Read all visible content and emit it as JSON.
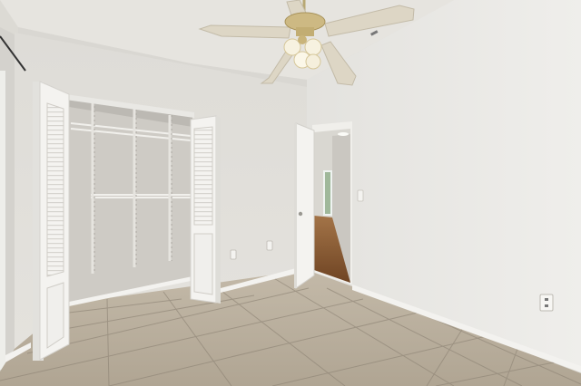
{
  "scene": {
    "colors": {
      "ceiling": "#e6e4df",
      "left_wall": "#d8d6d1",
      "back_wall": "#e2e0dc",
      "right_wall": "#e8e7e4",
      "closet_interior": "#cfcdc8",
      "floor_tile": "#b8ad9c",
      "grout": "#8f8576",
      "baseboard": "#f2f1ee",
      "door_white": "#f4f3f0",
      "hall_floor": "#8a5a32",
      "fan_blade": "#d9d2c2",
      "fan_brass": "#c9b47a"
    },
    "icons": [
      "ceiling-fan-icon",
      "light-fixture-icon",
      "outlet-icon",
      "door-knob-icon"
    ]
  }
}
